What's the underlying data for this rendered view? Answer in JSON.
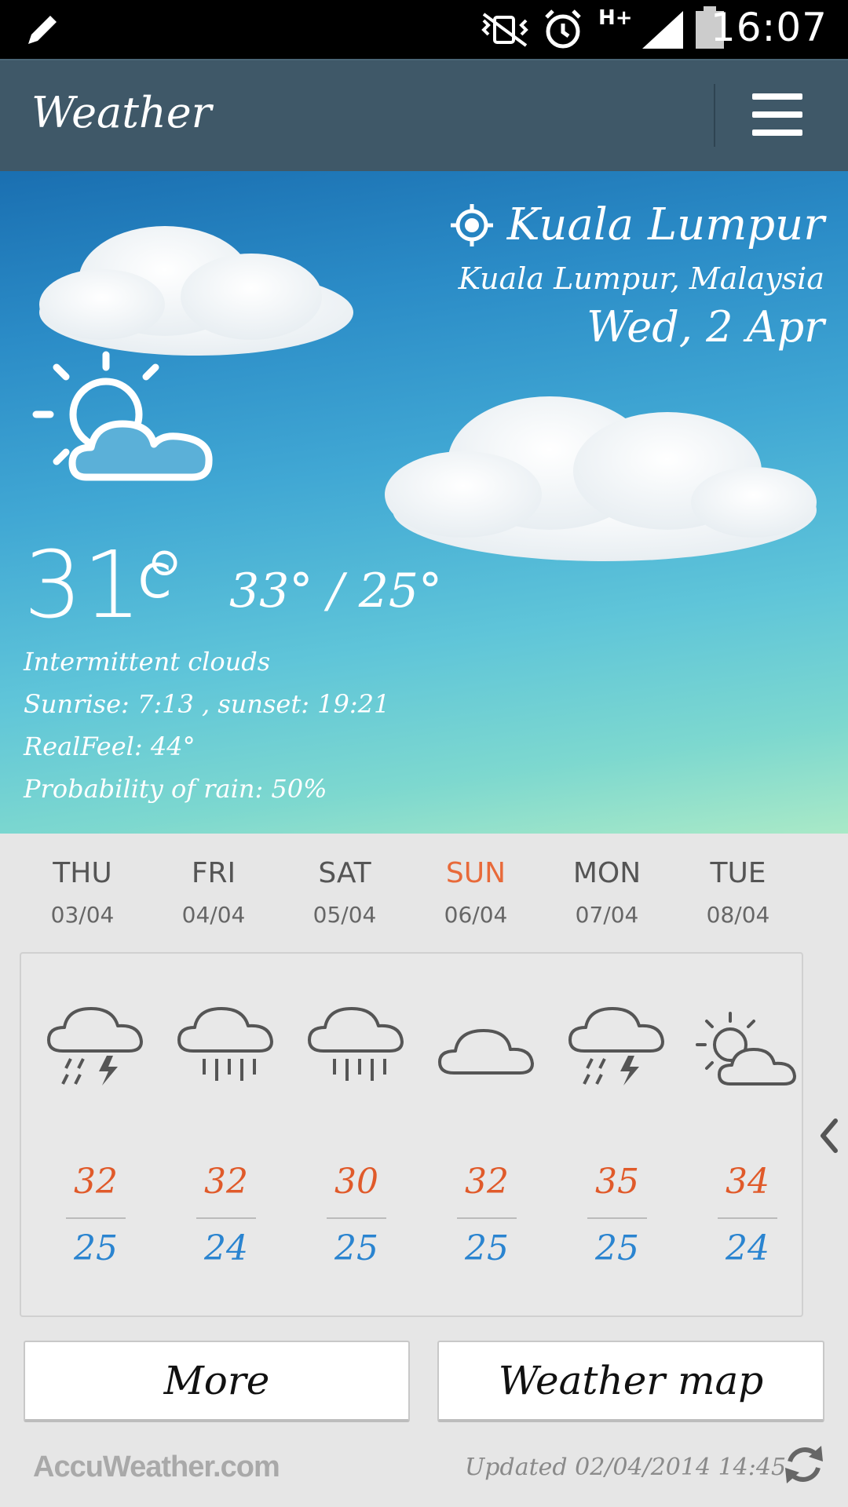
{
  "status_bar": {
    "time": "16:07",
    "icons": [
      "pencil-icon",
      "vibrate-mute-icon",
      "alarm-icon",
      "hplus-data-icon",
      "signal-icon",
      "battery-icon"
    ],
    "network_label": "H+"
  },
  "app_bar": {
    "title": "Weather",
    "menu_icon": "menu-icon"
  },
  "current": {
    "city": "Kuala Lumpur",
    "region": "Kuala Lumpur, Malaysia",
    "date": "Wed, 2 Apr",
    "temperature": "31°",
    "unit": "C",
    "high_low": "33° / 25°",
    "condition": "Intermittent clouds",
    "sunrise_sunset": "Sunrise: 7:13 , sunset: 19:21",
    "realfeel": "RealFeel: 44°",
    "rain_probability": "Probability of rain: 50%",
    "icon": "partly-cloudy-icon"
  },
  "forecast": [
    {
      "day": "THU",
      "date": "03/04",
      "icon": "thunderstorm-icon",
      "high": "32",
      "low": "25"
    },
    {
      "day": "FRI",
      "date": "04/04",
      "icon": "rain-icon",
      "high": "32",
      "low": "24"
    },
    {
      "day": "SAT",
      "date": "05/04",
      "icon": "rain-icon",
      "high": "30",
      "low": "25"
    },
    {
      "day": "SUN",
      "date": "06/04",
      "icon": "cloudy-icon",
      "high": "32",
      "low": "25"
    },
    {
      "day": "MON",
      "date": "07/04",
      "icon": "thunderstorm-icon",
      "high": "35",
      "low": "25"
    },
    {
      "day": "TUE",
      "date": "08/04",
      "icon": "partly-cloudy-icon",
      "high": "34",
      "low": "24"
    }
  ],
  "buttons": {
    "more": "More",
    "weather_map": "Weather map"
  },
  "footer": {
    "brand": "AccuWeather.com",
    "updated": "Updated 02/04/2014 14:45"
  },
  "colors": {
    "app_bar": "#3f5868",
    "high_temp": "#e05a2a",
    "low_temp": "#2a84d0",
    "sunday": "#e86a3a"
  }
}
